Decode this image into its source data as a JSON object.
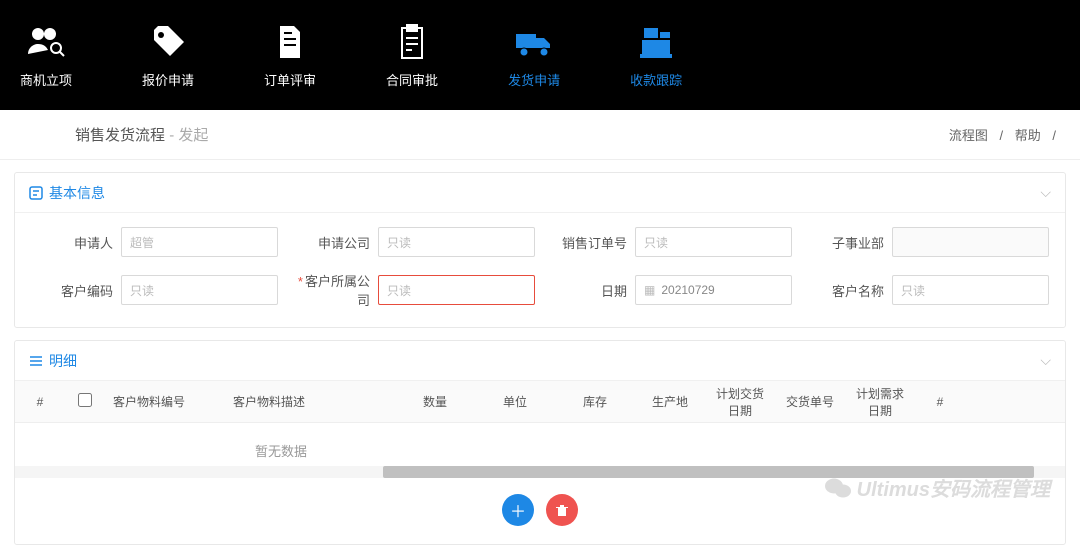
{
  "nav": {
    "items": [
      {
        "label": "商机立项",
        "active": false
      },
      {
        "label": "报价申请",
        "active": false
      },
      {
        "label": "订单评审",
        "active": false
      },
      {
        "label": "合同审批",
        "active": false
      },
      {
        "label": "发货申请",
        "active": true
      },
      {
        "label": "收款跟踪",
        "active": true
      }
    ]
  },
  "header": {
    "title": "销售发货流程",
    "subtitle": "- 发起",
    "links": [
      "流程图",
      "帮助"
    ],
    "sep": "/"
  },
  "panels": {
    "basic": {
      "title": "基本信息",
      "fields": {
        "applicant": {
          "label": "申请人",
          "value": "超管"
        },
        "applyCompany": {
          "label": "申请公司",
          "value": "只读"
        },
        "salesOrderNo": {
          "label": "销售订单号",
          "value": "只读"
        },
        "subBiz": {
          "label": "子事业部",
          "value": ""
        },
        "customerCode": {
          "label": "客户编码",
          "value": "只读"
        },
        "customerCompany": {
          "label": "客户所属公司",
          "value": "只读",
          "required": true
        },
        "date": {
          "label": "日期",
          "value": "20210729",
          "hasCalendar": true
        },
        "customerName": {
          "label": "客户名称",
          "value": "只读"
        }
      }
    },
    "detail": {
      "title": "明细",
      "columns": [
        "#",
        "",
        "客户物料编号",
        "客户物料描述",
        "数量",
        "单位",
        "库存",
        "生产地",
        "计划交货日期",
        "交货单号",
        "计划需求日期",
        "#"
      ],
      "empty": "暂无数据"
    }
  },
  "watermark": "Ultimus安码流程管理"
}
